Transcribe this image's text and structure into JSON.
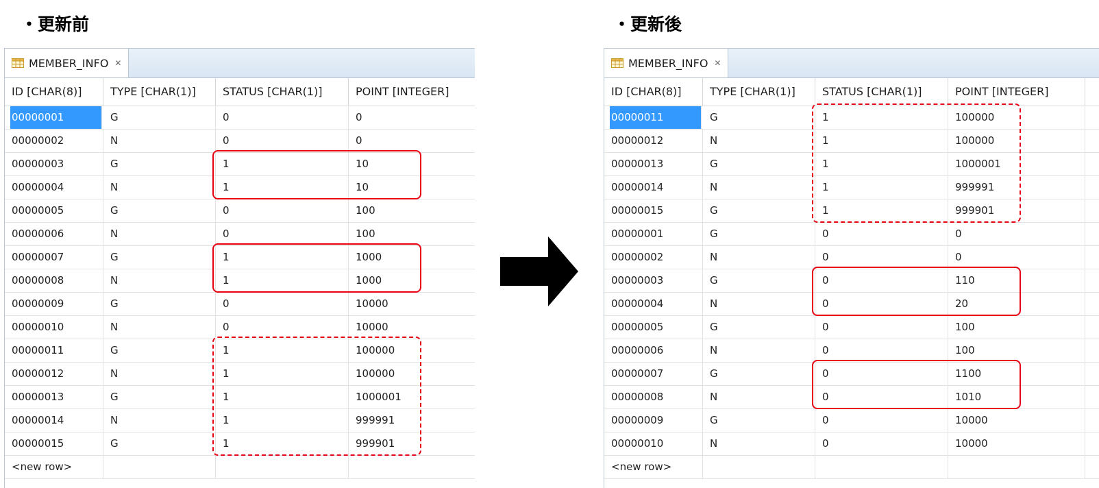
{
  "captions": {
    "before": "・更新前",
    "after": "・更新後"
  },
  "tab": {
    "title": "MEMBER_INFO",
    "table_icon": "table-grid-icon",
    "close_icon": "close-icon"
  },
  "columns": [
    "ID [CHAR(8)]",
    "TYPE [CHAR(1)]",
    "STATUS [CHAR(1)]",
    "POINT [INTEGER]"
  ],
  "new_row_label": "<new row>",
  "highlight_color": "#e60012",
  "selection_color": "#3399ff",
  "before": {
    "selected_row": 0,
    "rows": [
      [
        "00000001",
        "G",
        "0",
        "0"
      ],
      [
        "00000002",
        "N",
        "0",
        "0"
      ],
      [
        "00000003",
        "G",
        "1",
        "10"
      ],
      [
        "00000004",
        "N",
        "1",
        "10"
      ],
      [
        "00000005",
        "G",
        "0",
        "100"
      ],
      [
        "00000006",
        "N",
        "0",
        "100"
      ],
      [
        "00000007",
        "G",
        "1",
        "1000"
      ],
      [
        "00000008",
        "N",
        "1",
        "1000"
      ],
      [
        "00000009",
        "G",
        "0",
        "10000"
      ],
      [
        "00000010",
        "N",
        "0",
        "10000"
      ],
      [
        "00000011",
        "G",
        "1",
        "100000"
      ],
      [
        "00000012",
        "N",
        "1",
        "100000"
      ],
      [
        "00000013",
        "G",
        "1",
        "1000001"
      ],
      [
        "00000014",
        "N",
        "1",
        "999991"
      ],
      [
        "00000015",
        "G",
        "1",
        "999901"
      ]
    ],
    "highlights": [
      {
        "style": "solid",
        "rows": [
          2,
          3
        ]
      },
      {
        "style": "solid",
        "rows": [
          6,
          7
        ]
      },
      {
        "style": "dashed",
        "rows": [
          10,
          14
        ]
      }
    ]
  },
  "after": {
    "selected_row": 0,
    "rows": [
      [
        "00000011",
        "G",
        "1",
        "100000"
      ],
      [
        "00000012",
        "N",
        "1",
        "100000"
      ],
      [
        "00000013",
        "G",
        "1",
        "1000001"
      ],
      [
        "00000014",
        "N",
        "1",
        "999991"
      ],
      [
        "00000015",
        "G",
        "1",
        "999901"
      ],
      [
        "00000001",
        "G",
        "0",
        "0"
      ],
      [
        "00000002",
        "N",
        "0",
        "0"
      ],
      [
        "00000003",
        "G",
        "0",
        "110"
      ],
      [
        "00000004",
        "N",
        "0",
        "20"
      ],
      [
        "00000005",
        "G",
        "0",
        "100"
      ],
      [
        "00000006",
        "N",
        "0",
        "100"
      ],
      [
        "00000007",
        "G",
        "0",
        "1100"
      ],
      [
        "00000008",
        "N",
        "0",
        "1010"
      ],
      [
        "00000009",
        "G",
        "0",
        "10000"
      ],
      [
        "00000010",
        "N",
        "0",
        "10000"
      ]
    ],
    "highlights": [
      {
        "style": "dashed",
        "rows": [
          0,
          4
        ]
      },
      {
        "style": "solid",
        "rows": [
          7,
          8
        ]
      },
      {
        "style": "solid",
        "rows": [
          11,
          12
        ]
      }
    ]
  },
  "arrow_icon": "right-arrow-icon"
}
